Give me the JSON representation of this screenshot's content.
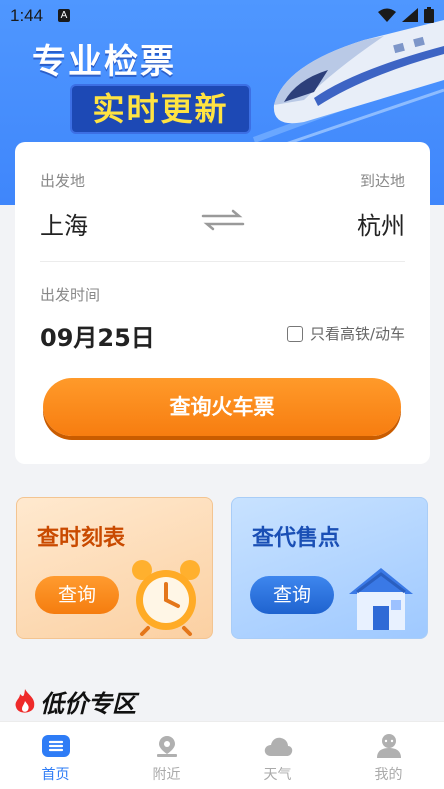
{
  "status_bar": {
    "time": "1:44",
    "notification_letter": "A"
  },
  "banner": {
    "title": "专业检票",
    "subtitle": "实时更新"
  },
  "search": {
    "from_label": "出发地",
    "to_label": "到达地",
    "from_city": "上海",
    "to_city": "杭州",
    "date_label": "出发时间",
    "date_value": "09月25日",
    "highspeed_only_label": "只看高铁/动车",
    "highspeed_only_checked": false,
    "submit_label": "查询火车票"
  },
  "features": [
    {
      "title": "查时刻表",
      "button": "查询"
    },
    {
      "title": "查代售点",
      "button": "查询"
    }
  ],
  "lowprice": {
    "title": "低价专区"
  },
  "tabbar": {
    "items": [
      {
        "label": "首页",
        "icon": "home-icon",
        "active": true
      },
      {
        "label": "附近",
        "icon": "location-icon",
        "active": false
      },
      {
        "label": "天气",
        "icon": "cloud-icon",
        "active": false
      },
      {
        "label": "我的",
        "icon": "profile-icon",
        "active": false
      }
    ]
  },
  "colors": {
    "primary": "#2e7cf6",
    "accent_orange": "#f77d10",
    "banner_blue": "#4f97ff",
    "highlight_yellow": "#ffe342"
  }
}
